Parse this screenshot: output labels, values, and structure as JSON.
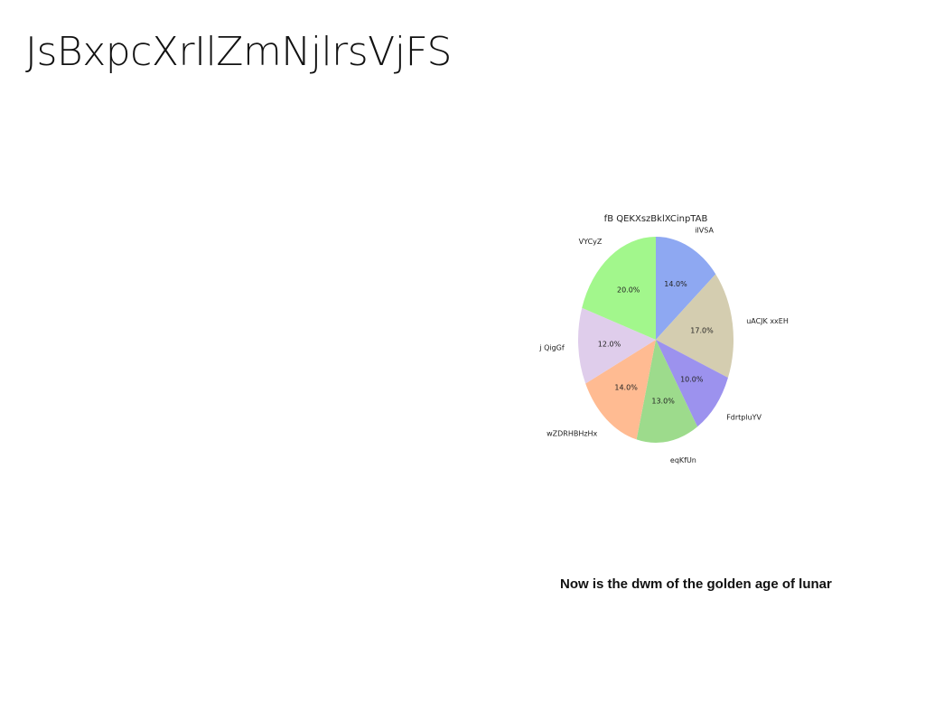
{
  "page": {
    "title": "JsBxpcXrIlZmNjlrsVjFS",
    "caption": "Now is the dwm of the  golden age of lunar"
  },
  "chart_data": {
    "type": "pie",
    "title": "fB QEKXszBklXCinpTAB",
    "start_angle_deg": 90,
    "direction": "clockwise",
    "categories": [
      "iIVSA",
      "uACJK xxEH",
      "FdrtpluYV",
      "eqKfUn",
      "wZDRHBHzHx",
      "j QigGf",
      "VYCyZ"
    ],
    "values": [
      14.0,
      17.0,
      10.0,
      13.0,
      14.0,
      12.0,
      20.0
    ],
    "value_labels": [
      "14.0%",
      "17.0%",
      "10.0%",
      "13.0%",
      "14.0%",
      "12.0%",
      "20.0%"
    ],
    "colors": [
      "#8ea8f2",
      "#d4cdb0",
      "#9c92ee",
      "#9ddb8c",
      "#ffbb92",
      "#dfcdeb",
      "#a2f78c"
    ]
  }
}
